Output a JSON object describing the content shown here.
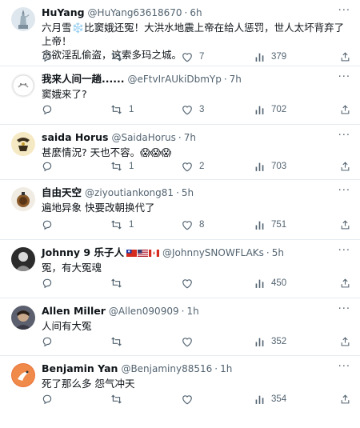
{
  "tweets": [
    {
      "name": "HuYang",
      "handle": "@HuYang63618670",
      "time": "6h",
      "text": "六月雪❄️比窦娥还冤！大洪水地震上帝在给人惩罚，世人太坏背弃了上帝！\n贪欲淫乱偷盗，这索多玛之城。",
      "replies": "",
      "retweets": "",
      "likes": "7",
      "views": "379"
    },
    {
      "name": "我来人间一趟......",
      "handle": "@eFtvIrAUkiDbmYp",
      "time": "7h",
      "text": "窦娥来了?",
      "replies": "",
      "retweets": "1",
      "likes": "3",
      "views": "702"
    },
    {
      "name": "saida Horus",
      "handle": "@SaidaHorus",
      "time": "7h",
      "text": "甚麼情況? 天也不容。😱😱😱",
      "replies": "",
      "retweets": "1",
      "likes": "2",
      "views": "703"
    },
    {
      "name": "自由天空",
      "handle": "@ziyoutiankong81",
      "time": "5h",
      "text": "遍地异象 快要改朝换代了",
      "replies": "",
      "retweets": "1",
      "likes": "8",
      "views": "751"
    },
    {
      "name": "Johnny 9 乐子人",
      "handle": "@JohnnySNOWFLAKs",
      "time": "5h",
      "text": "冤，有大冤魂",
      "replies": "",
      "retweets": "",
      "likes": "",
      "views": "450"
    },
    {
      "name": "Allen Miller",
      "handle": "@Allen090909",
      "time": "1h",
      "text": "人间有大冤",
      "replies": "",
      "retweets": "",
      "likes": "",
      "views": "352"
    },
    {
      "name": "Benjamin Yan",
      "handle": "@Benjaminy88516",
      "time": "1h",
      "text": "死了那么多 怨气冲天",
      "replies": "",
      "retweets": "",
      "likes": "",
      "views": "354"
    }
  ],
  "colors": {
    "text": "#0f1419",
    "secondary": "#536471",
    "divider": "#e6ecf0"
  }
}
